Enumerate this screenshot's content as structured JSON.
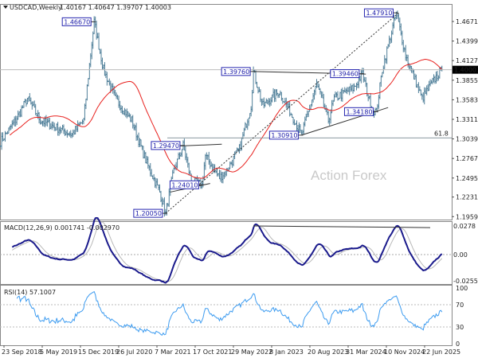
{
  "header": {
    "symbol": "USDCAD,Weekly",
    "ohlc": "1.40167 1.40647 1.39707 1.40003"
  },
  "watermark": "Action Forex",
  "colors": {
    "bars": "#4f7f99",
    "ma": "#e8211e",
    "macd": "#1a1a8c",
    "signal": "#b8b8b8",
    "rsi": "#3c9bf0",
    "annotation": "#2626b0",
    "current_price_bg": "#000000"
  },
  "chart_data": [
    {
      "type": "ohlc",
      "title": "USDCAD,Weekly",
      "last": {
        "open": 1.40167,
        "high": 1.40647,
        "low": 1.39707,
        "close": 1.40003
      },
      "current_price_label": "1.40003",
      "y_ticks": [
        "1.46710",
        "1.43990",
        "1.41270",
        "1.38550",
        "1.35830",
        "1.33110",
        "1.30390",
        "1.27670",
        "1.24950",
        "1.22310",
        "1.19590"
      ],
      "ylim": [
        1.1935,
        1.4985
      ],
      "x_ticks": [
        "23 Sep 2018",
        "5 May 2019",
        "15 Dec 2019",
        "26 Jul 2020",
        "7 Mar 2021",
        "17 Oct 2021",
        "29 May 2022",
        "8 Jan 2023",
        "20 Aug 2023",
        "31 Mar 2024",
        "10 Nov 2024",
        "22 Jun 2025"
      ],
      "fib_label": "61.8",
      "fib_level": 1.3053,
      "annotations": [
        {
          "label": "1.46670",
          "date": "2020-03-15",
          "price": 1.4667
        },
        {
          "label": "1.20050",
          "date": "2021-05-16",
          "price": 1.2005
        },
        {
          "label": "1.29470",
          "date": "2021-08-29",
          "price": 1.2947
        },
        {
          "label": "1.24010",
          "date": "2021-12-19",
          "price": 1.2401
        },
        {
          "label": "1.39760",
          "date": "2022-10-23",
          "price": 1.3976
        },
        {
          "label": "1.30910",
          "date": "2023-08-06",
          "price": 1.3091
        },
        {
          "label": "1.39460",
          "date": "2024-08-04",
          "price": 1.3946
        },
        {
          "label": "1.34180",
          "date": "2024-10-27",
          "price": 1.3418
        },
        {
          "label": "1.47910",
          "date": "2025-02-23",
          "price": 1.4791
        }
      ],
      "swing_points": [
        [
          "2018-09-02",
          1.3
        ],
        [
          "2018-12-02",
          1.33
        ],
        [
          "2019-02-10",
          1.36
        ],
        [
          "2019-04-28",
          1.33
        ],
        [
          "2019-07-28",
          1.32
        ],
        [
          "2019-11-03",
          1.31
        ],
        [
          "2020-01-12",
          1.33
        ],
        [
          "2020-03-15",
          1.4667
        ],
        [
          "2020-05-10",
          1.4
        ],
        [
          "2020-07-19",
          1.36
        ],
        [
          "2020-10-25",
          1.33
        ],
        [
          "2021-01-24",
          1.27
        ],
        [
          "2021-04-11",
          1.23
        ],
        [
          "2021-05-16",
          1.2005
        ],
        [
          "2021-07-04",
          1.26
        ],
        [
          "2021-08-29",
          1.2947
        ],
        [
          "2021-10-17",
          1.245
        ],
        [
          "2021-12-19",
          1.2401
        ],
        [
          "2022-01-09",
          1.28
        ],
        [
          "2022-04-03",
          1.25
        ],
        [
          "2022-05-15",
          1.26
        ],
        [
          "2022-07-31",
          1.29
        ],
        [
          "2022-10-09",
          1.35
        ],
        [
          "2022-10-23",
          1.3976
        ],
        [
          "2022-12-18",
          1.35
        ],
        [
          "2023-03-26",
          1.37
        ],
        [
          "2023-06-25",
          1.33
        ],
        [
          "2023-08-06",
          1.3091
        ],
        [
          "2023-11-05",
          1.38
        ],
        [
          "2024-01-14",
          1.33
        ],
        [
          "2024-02-18",
          1.36
        ],
        [
          "2024-06-16",
          1.375
        ],
        [
          "2024-08-04",
          1.3946
        ],
        [
          "2024-09-29",
          1.345
        ],
        [
          "2024-10-27",
          1.3418
        ],
        [
          "2024-12-01",
          1.4
        ],
        [
          "2025-02-23",
          1.4791
        ],
        [
          "2025-04-20",
          1.42
        ],
        [
          "2025-07-27",
          1.36
        ],
        [
          "2025-10-19",
          1.39
        ],
        [
          "2025-11-23",
          1.40003
        ]
      ]
    },
    {
      "type": "line",
      "title": "MACD(12,26,9) 0.001741 -0.002970",
      "y_ticks": [
        "0.0278",
        "0.00",
        "-0.025511"
      ],
      "ylim": [
        -0.025511,
        0.0278
      ]
    },
    {
      "type": "line",
      "title": "RSI(14) 57.1007",
      "y_ticks": [
        "100",
        "70",
        "30",
        "0"
      ],
      "ylim": [
        0,
        100
      ]
    }
  ]
}
